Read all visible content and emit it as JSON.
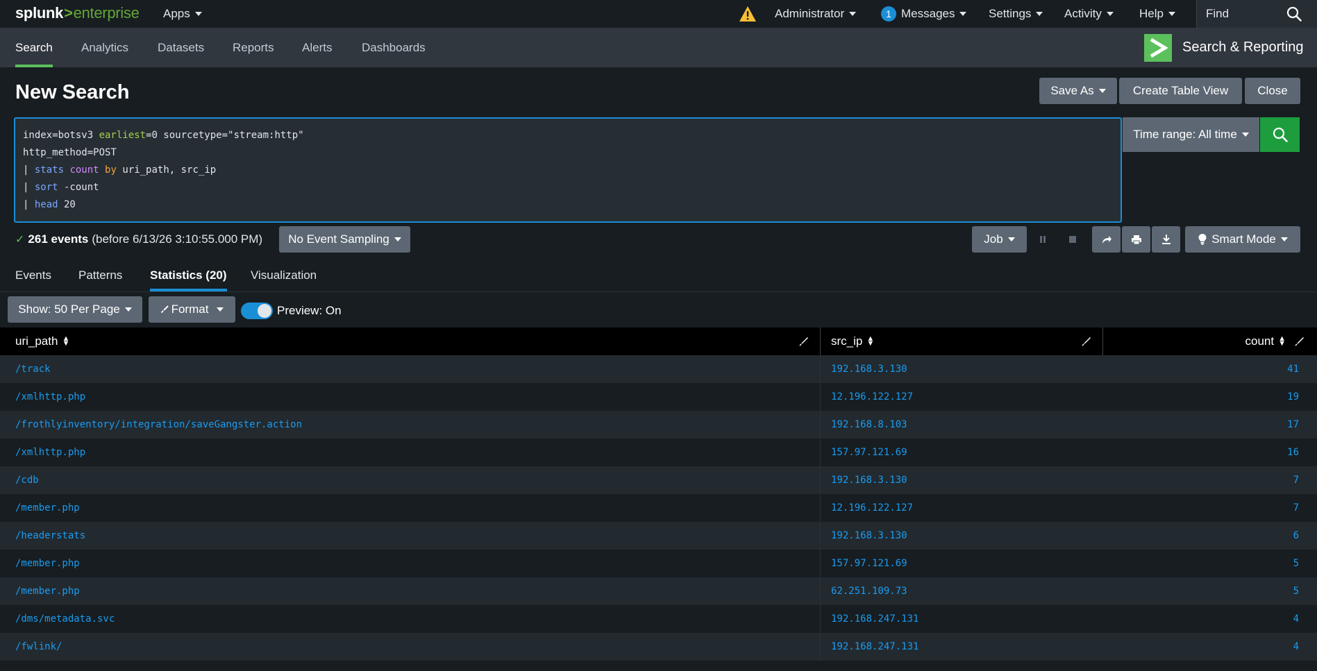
{
  "topbar": {
    "logo_splunk": "splunk",
    "logo_arrow": ">",
    "logo_enterprise": "enterprise",
    "apps": "Apps",
    "user": "Administrator",
    "messages_count": "1",
    "messages": "Messages",
    "settings": "Settings",
    "activity": "Activity",
    "help": "Help",
    "find": "Find"
  },
  "appbar": {
    "tabs": [
      "Search",
      "Analytics",
      "Datasets",
      "Reports",
      "Alerts",
      "Dashboards"
    ],
    "active_tab": "Search",
    "app_title": "Search & Reporting"
  },
  "page": {
    "title": "New Search",
    "save_as": "Save As",
    "create_table_view": "Create Table View",
    "close": "Close"
  },
  "search": {
    "line1_a": "index=botsv3 ",
    "line1_b": "earliest",
    "line1_c": "=0 sourcetype=\"stream:http\"",
    "line2": "http_method=POST",
    "line3_a": "| ",
    "line3_b": "stats",
    "line3_c": " ",
    "line3_d": "count",
    "line3_e": " ",
    "line3_f": "by",
    "line3_g": " uri_path, src_ip",
    "line4_a": "| ",
    "line4_b": "sort",
    "line4_c": " -count",
    "line5_a": "| ",
    "line5_b": "head",
    "line5_c": " 20",
    "time_range": "Time range: All time"
  },
  "status": {
    "events": "261 events",
    "before": "(before 6/13/26 3:10:55.000 PM)",
    "sampling": "No Event Sampling",
    "job": "Job",
    "smart_mode": "Smart Mode"
  },
  "result_tabs": [
    "Events",
    "Patterns",
    "Statistics (20)",
    "Visualization"
  ],
  "controls": {
    "show": "Show: 50 Per Page",
    "format": "Format",
    "preview": "Preview: On",
    "preview_on": true
  },
  "table": {
    "columns": [
      "uri_path",
      "src_ip",
      "count"
    ],
    "rows": [
      [
        "/track",
        "192.168.3.130",
        "41"
      ],
      [
        "/xmlhttp.php",
        "12.196.122.127",
        "19"
      ],
      [
        "/frothlyinventory/integration/saveGangster.action",
        "192.168.8.103",
        "17"
      ],
      [
        "/xmlhttp.php",
        "157.97.121.69",
        "16"
      ],
      [
        "/cdb",
        "192.168.3.130",
        "7"
      ],
      [
        "/member.php",
        "12.196.122.127",
        "7"
      ],
      [
        "/headerstats",
        "192.168.3.130",
        "6"
      ],
      [
        "/member.php",
        "157.97.121.69",
        "5"
      ],
      [
        "/member.php",
        "62.251.109.73",
        "5"
      ],
      [
        "/dms/metadata.svc",
        "192.168.247.131",
        "4"
      ],
      [
        "/fwlink/",
        "192.168.247.131",
        "4"
      ]
    ]
  },
  "colors": {
    "accent_green": "#5cc05c",
    "accent_blue": "#1a8fd6",
    "link_blue": "#1a9cf0",
    "background": "#171d21"
  }
}
